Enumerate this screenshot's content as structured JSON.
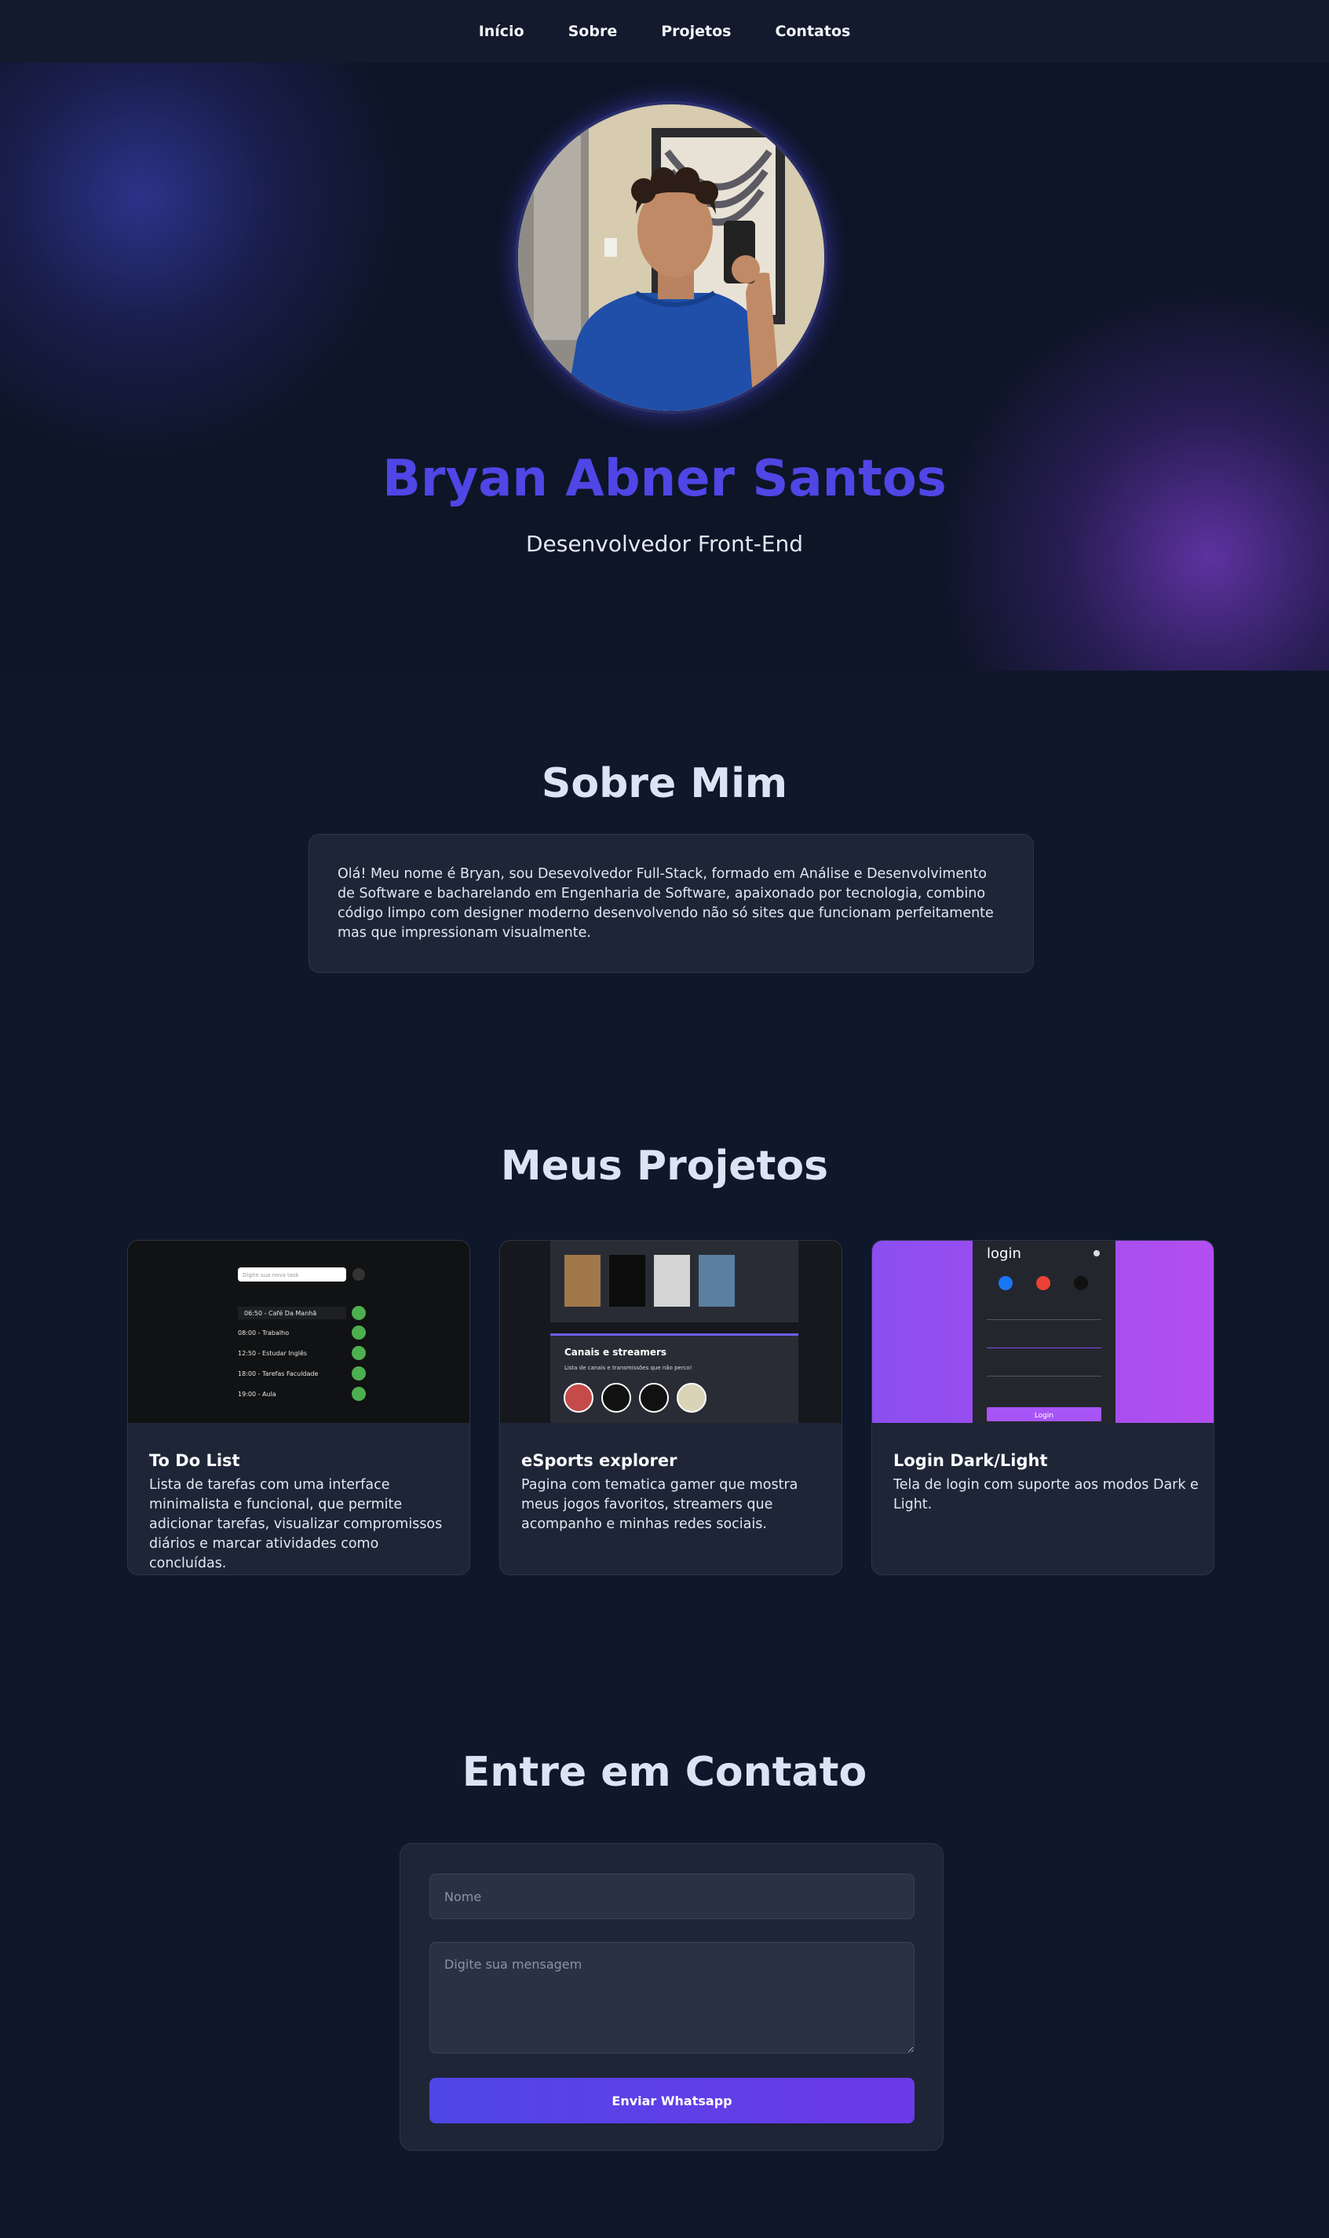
{
  "nav": {
    "items": [
      "Início",
      "Sobre",
      "Projetos",
      "Contatos"
    ]
  },
  "hero": {
    "name": "Bryan Abner Santos",
    "role": "Desenvolvedor Front-End"
  },
  "about": {
    "title": "Sobre Mim",
    "text": "Olá! Meu nome é Bryan, sou Desevolvedor Full-Stack, formado em Análise e Desenvolvimento de Software e bacharelando em Engenharia de Software, apaixonado por tecnologia, combino código limpo com designer moderno desenvolvendo não só sites que funcionam perfeitamente mas que impressionam visualmente."
  },
  "projects": {
    "title": "Meus Projetos",
    "items": [
      {
        "title": "To Do List",
        "description": "Lista de tarefas com uma interface minimalista e funcional, que permite adicionar tarefas, visualizar compromissos diários e marcar atividades como concluídas.",
        "preview": {
          "input_placeholder": "Digite sua nova task",
          "tasks": [
            "06:50 - Café Da Manhã",
            "08:00 - Trabalho",
            "12:50 - Estudar Inglês",
            "18:00 - Tarefas Faculdade",
            "19:00 - Aula"
          ]
        }
      },
      {
        "title": "eSports explorer",
        "description": "Pagina com tematica gamer que mostra meus jogos favoritos, streamers que acompanho e minhas redes sociais.",
        "preview": {
          "heading": "Canais e streamers",
          "subheading": "Lista de canais e transmissões que não perco!"
        }
      },
      {
        "title": "Login Dark/Light",
        "description": "Tela de login com suporte aos modos Dark e Light.",
        "preview": {
          "heading": "login",
          "button": "Login"
        }
      }
    ]
  },
  "contact": {
    "title": "Entre em Contato",
    "name_placeholder": "Nome",
    "message_placeholder": "Digite sua mensagem",
    "button": "Enviar Whatsapp"
  },
  "colors": {
    "accent": "#4f46e5",
    "background": "#0f172a",
    "card": "#1e2536",
    "success": "#4caf50",
    "login_purple": "#a855f7"
  }
}
